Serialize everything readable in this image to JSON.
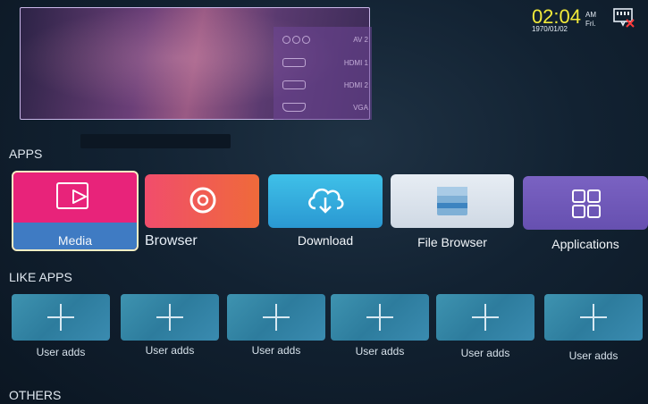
{
  "status": {
    "time": "02:04",
    "ampm": "AM",
    "date": "1970/01/02",
    "weekday": "Fri.",
    "network_icon": "network-disconnected-icon",
    "time_color": "#f2ea3a"
  },
  "sources": [
    {
      "label": "AV 2",
      "icon": "av-icon"
    },
    {
      "label": "HDMI 1",
      "icon": "hdmi-icon"
    },
    {
      "label": "HDMI 2",
      "icon": "hdmi-icon"
    },
    {
      "label": "VGA",
      "icon": "vga-icon"
    }
  ],
  "sections": {
    "apps": "APPS",
    "like_apps": "LIKE APPS",
    "others": "OTHERS"
  },
  "apps": [
    {
      "label": "Media",
      "icon": "media-play-icon",
      "color": "#e8237a",
      "selected": true
    },
    {
      "label": "Browser",
      "icon": "browser-icon",
      "color": "#ee5a3c"
    },
    {
      "label": "Download",
      "icon": "cloud-download-icon",
      "color": "#2fa8db"
    },
    {
      "label": "File Browser",
      "icon": "folder-icon",
      "color": "#dde4ec"
    },
    {
      "label": "Applications",
      "icon": "grid-icon",
      "color": "#7159b8"
    }
  ],
  "like_apps": [
    {
      "label": "User adds"
    },
    {
      "label": "User adds"
    },
    {
      "label": "User adds"
    },
    {
      "label": "User adds"
    },
    {
      "label": "User adds"
    },
    {
      "label": "User adds"
    }
  ]
}
